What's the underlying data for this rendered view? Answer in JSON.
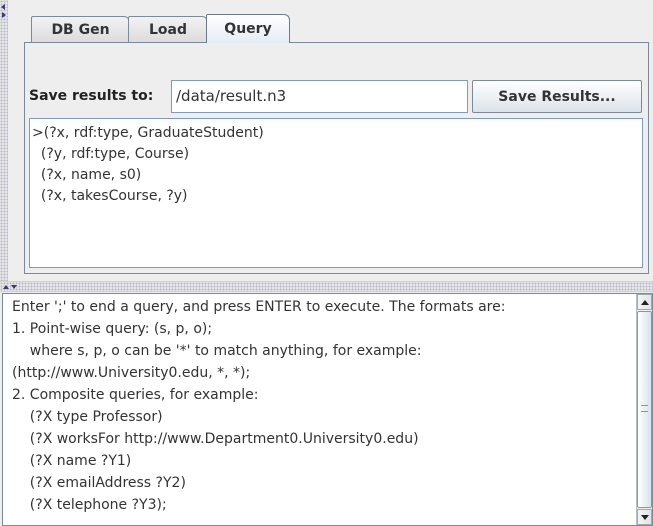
{
  "tabs": [
    {
      "label": "DB Gen"
    },
    {
      "label": "Load"
    },
    {
      "label": "Query",
      "selected": true
    }
  ],
  "save": {
    "label": "Save results to:",
    "path_value": "/data/result.n3",
    "button_label": "Save Results..."
  },
  "query_lines": [
    ">(?x, rdf:type, GraduateStudent)",
    "  (?y, rdf:type, Course)",
    "  (?x, name, s0)",
    "  (?x, takesCourse, ?y)"
  ],
  "console_lines": [
    "Enter ';' to end a query, and press ENTER to execute. The formats are:",
    "1. Point-wise query: (s, p, o);",
    "    where s, p, o can be '*' to match anything, for example:",
    "(http://www.University0.edu, *, *);",
    "2. Composite queries, for example:",
    "    (?X type Professor)",
    "    (?X worksFor http://www.Department0.University0.edu)",
    "    (?X name ?Y1)",
    "    (?X emailAddress ?Y2)",
    "    (?X telephone ?Y3);"
  ],
  "colors": {
    "panel_bg": "#eeeeee",
    "border": "#7a8a99",
    "field_border": "#7f9db9"
  },
  "icons": {
    "collapse_left": "collapse-left-arrow-icon",
    "collapse_right": "collapse-right-arrow-icon",
    "split_up": "split-up-arrow-icon",
    "split_down": "split-down-arrow-icon",
    "scroll_up": "scroll-up-arrow-icon",
    "scroll_down": "scroll-down-arrow-icon"
  }
}
